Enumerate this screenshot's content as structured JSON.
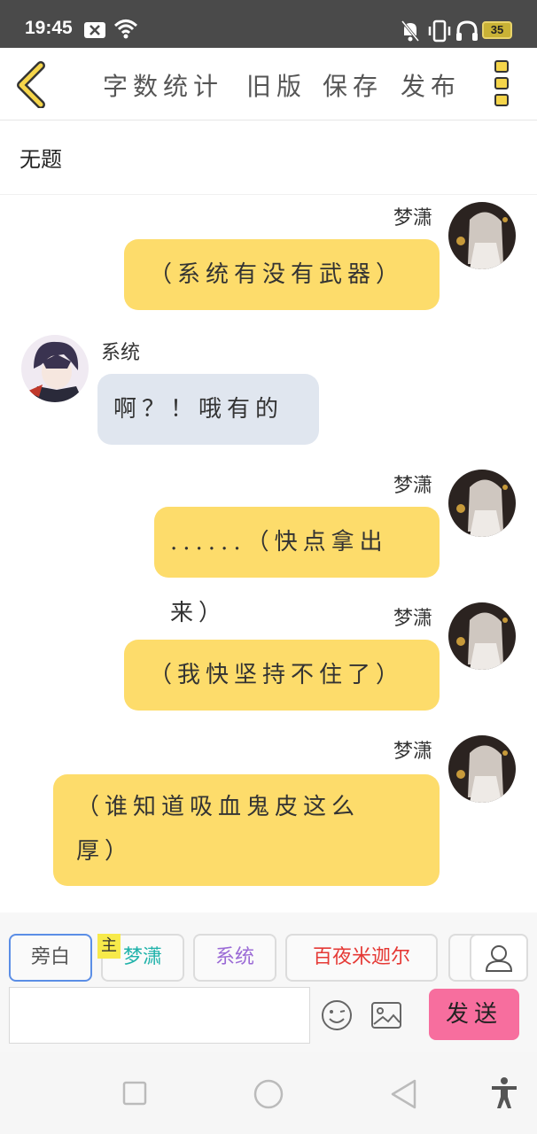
{
  "status_bar": {
    "time": "19:45",
    "battery": "35",
    "icons": [
      "close-box-icon",
      "wifi-icon",
      "mute-bell-icon",
      "vibrate-icon",
      "headphones-icon",
      "battery-icon"
    ]
  },
  "toolbar": {
    "back_icon": "chevron-left-icon",
    "items": [
      "字数统计",
      "旧版",
      "保存",
      "发布"
    ],
    "more_icon": "more-vertical-icon"
  },
  "title": "无题",
  "messages": [
    {
      "sender": "梦潇",
      "side": "right",
      "text": "（系统有没有武器）"
    },
    {
      "sender": "系统",
      "side": "left",
      "text": "啊？！哦有的"
    },
    {
      "sender": "梦潇",
      "side": "right",
      "text": "......（快点拿出来）"
    },
    {
      "sender": "梦潇",
      "side": "right",
      "text": "（我快坚持不住了）"
    },
    {
      "sender": "梦潇",
      "side": "right",
      "text_lines": [
        "（谁知道吸血鬼皮这么",
        "厚）"
      ]
    }
  ],
  "roles": {
    "chips": [
      "旁白",
      "梦潇",
      "系统",
      "百夜米迦尔"
    ],
    "owner_tag": "主",
    "selected": "旁白",
    "colors": {
      "旁白": "#555555",
      "梦潇": "#20b2aa",
      "系统": "#9b6bd6",
      "百夜米迦尔": "#e53935"
    }
  },
  "input": {
    "placeholder": "",
    "send_label": "发送"
  },
  "colors": {
    "my_bubble": "#fddc6b",
    "their_bubble": "#e0e6ef",
    "send_button": "#f76e9e",
    "accent_yellow": "#f5d54a"
  }
}
